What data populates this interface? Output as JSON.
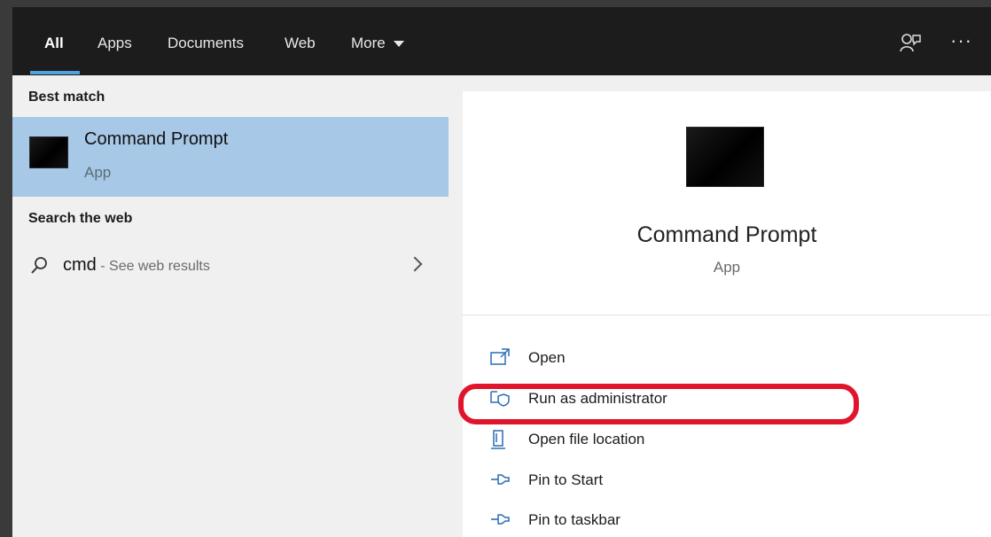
{
  "tabs": [
    {
      "label": "All",
      "active": true
    },
    {
      "label": "Apps"
    },
    {
      "label": "Documents"
    },
    {
      "label": "Web"
    },
    {
      "label": "More"
    }
  ],
  "icons": {
    "feedback": "feedback-person-icon",
    "more_options": "ellipsis-icon",
    "search": "search-icon",
    "chevron": "chevron-right-icon"
  },
  "more_options_label": "···",
  "best_match": {
    "section_title": "Best match",
    "name": "Command Prompt",
    "type": "App"
  },
  "search_web": {
    "section_title": "Search the web",
    "query": "cmd",
    "hint": " - See web results"
  },
  "preview": {
    "name": "Command Prompt",
    "type": "App"
  },
  "actions": [
    {
      "label": "Open",
      "icon": "open-icon"
    },
    {
      "label": "Run as administrator",
      "icon": "shield-admin-icon"
    },
    {
      "label": "Open file location",
      "icon": "file-location-icon"
    },
    {
      "label": "Pin to Start",
      "icon": "pin-icon"
    },
    {
      "label": "Pin to taskbar",
      "icon": "pin-icon"
    }
  ],
  "colors": {
    "accent": "#4fa3e0",
    "selection": "#a7c8e6",
    "highlight_ring": "#e0142b",
    "topbar": "#1c1c1c"
  }
}
